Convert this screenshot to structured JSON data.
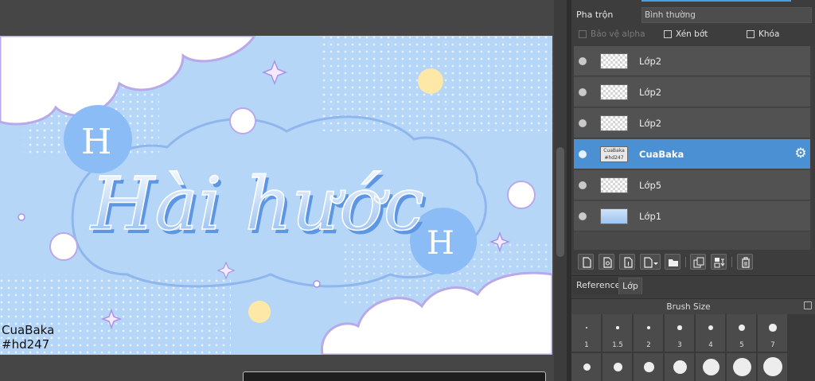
{
  "canvas": {
    "artwork_title": "Hài hước",
    "watermark_line1": "CuaBaka",
    "watermark_line2": "#hd247"
  },
  "layer_props": {
    "blend_label": "Pha trộn",
    "blend_value": "Bình thường",
    "protect_alpha": "Bảo vệ alpha",
    "clipping": "Xén bớt",
    "lock": "Khóa"
  },
  "layers": [
    {
      "name": "Lớp2",
      "selected": false,
      "thumb": "checker"
    },
    {
      "name": "Lớp2",
      "selected": false,
      "thumb": "checker"
    },
    {
      "name": "Lớp2",
      "selected": false,
      "thumb": "checker"
    },
    {
      "name": "CuaBaka",
      "selected": true,
      "thumb": "cua",
      "thumb_text": "CuaBaka #hd247"
    },
    {
      "name": "Lớp5",
      "selected": false,
      "thumb": "checker"
    },
    {
      "name": "Lớp1",
      "selected": false,
      "thumb": "sky"
    }
  ],
  "layer_tools": [
    "new-layer-icon",
    "new-vector-layer-icon",
    "new-raster-layer-icon",
    "add-layer-menu-icon",
    "folder-icon",
    "duplicate-icon",
    "merge-down-icon",
    "trash-icon"
  ],
  "tabs": {
    "reference": "Reference",
    "layer": "Lớp"
  },
  "brush_size": {
    "title": "Brush Size",
    "sizes": [
      "1",
      "1.5",
      "2",
      "3",
      "4",
      "5",
      "7"
    ],
    "dot_count_row2": 7
  },
  "colors": {
    "accent": "#4a90d2",
    "panel": "#3d3d3d",
    "sky": "#b6d6f8"
  }
}
